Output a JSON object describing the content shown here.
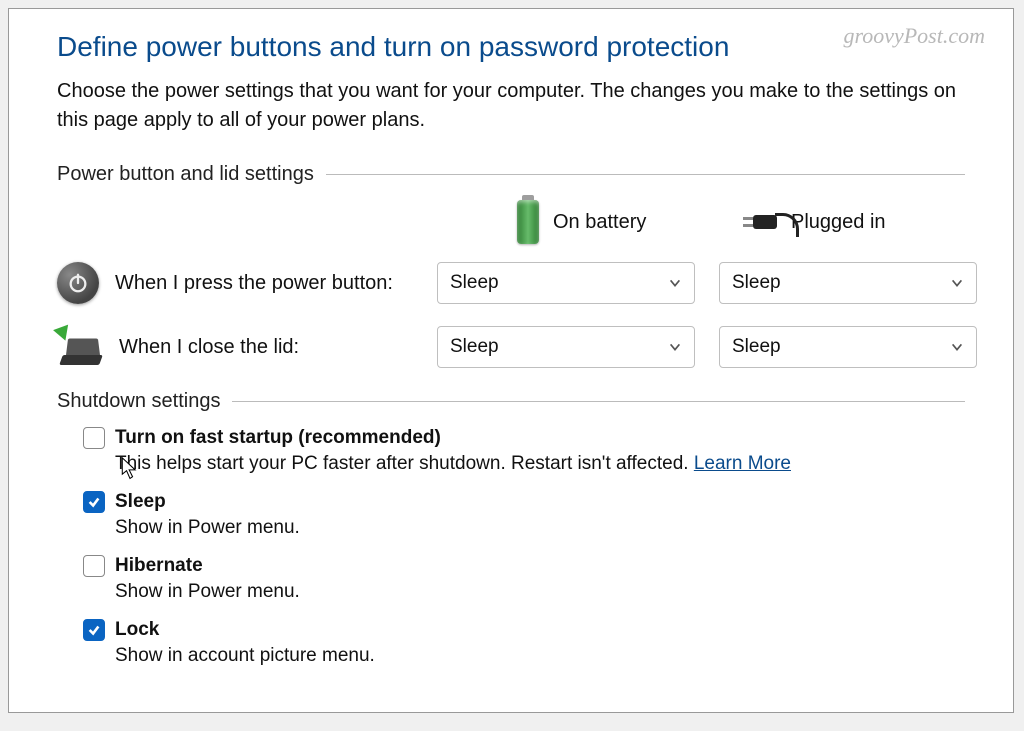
{
  "watermark": "groovyPost.com",
  "header": {
    "title": "Define power buttons and turn on password protection",
    "description": "Choose the power settings that you want for your computer. The changes you make to the settings on this page apply to all of your power plans."
  },
  "sections": {
    "power_lid": {
      "label": "Power button and lid settings",
      "columns": {
        "battery": "On battery",
        "plugged": "Plugged in"
      },
      "rows": [
        {
          "id": "power-button",
          "label": "When I press the power button:",
          "battery_value": "Sleep",
          "plugged_value": "Sleep"
        },
        {
          "id": "close-lid",
          "label": "When I close the lid:",
          "battery_value": "Sleep",
          "plugged_value": "Sleep"
        }
      ]
    },
    "shutdown": {
      "label": "Shutdown settings",
      "items": [
        {
          "id": "fast-startup",
          "title": "Turn on fast startup (recommended)",
          "desc_prefix": "This helps start your PC faster after shutdown. Restart isn't affected. ",
          "learn_more": "Learn More",
          "checked": false
        },
        {
          "id": "sleep",
          "title": "Sleep",
          "desc": "Show in Power menu.",
          "checked": true
        },
        {
          "id": "hibernate",
          "title": "Hibernate",
          "desc": "Show in Power menu.",
          "checked": false
        },
        {
          "id": "lock",
          "title": "Lock",
          "desc": "Show in account picture menu.",
          "checked": true
        }
      ]
    }
  }
}
